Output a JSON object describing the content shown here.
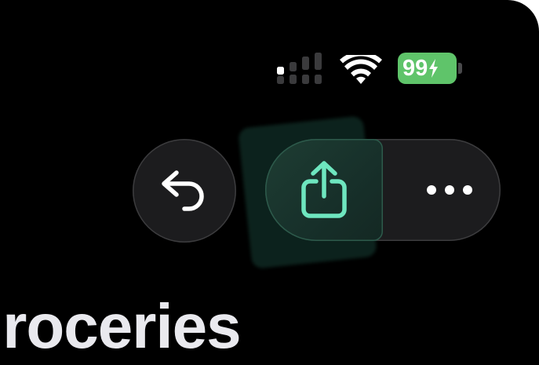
{
  "status_bar": {
    "battery_percent": "99",
    "battery_color": "#5fc46a",
    "battery_charging": true,
    "signal_bars_active": 1,
    "signal_bars_total": 4,
    "icons": [
      "cellular-signal-icon",
      "wifi-icon",
      "battery-icon",
      "charging-bolt-icon"
    ]
  },
  "toolbar": {
    "reply_icon": "reply-arrow-icon",
    "share_icon": "share-icon",
    "more_icon": "ellipsis-icon",
    "accent_color": "#6ee6bf",
    "share_selected": true
  },
  "page": {
    "title": "Groceries"
  }
}
